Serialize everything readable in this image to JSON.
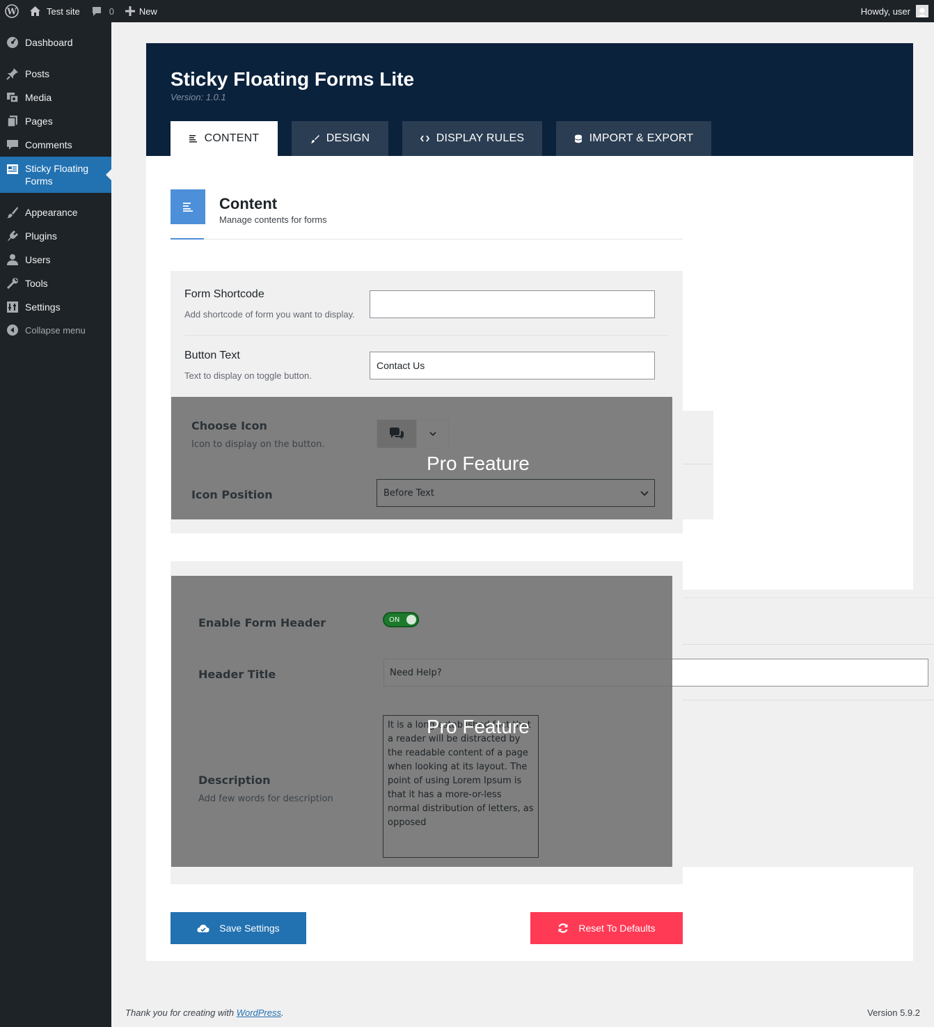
{
  "adminbar": {
    "site_name": "Test site",
    "comments_count": "0",
    "new_label": "New",
    "howdy": "Howdy, user"
  },
  "sidebar": {
    "items": [
      {
        "label": "Dashboard",
        "icon": "dashboard-icon"
      },
      {
        "label": "Posts",
        "icon": "pushpin-icon"
      },
      {
        "label": "Media",
        "icon": "media-icon"
      },
      {
        "label": "Pages",
        "icon": "pages-icon"
      },
      {
        "label": "Comments",
        "icon": "comment-icon"
      },
      {
        "label": "Sticky Floating Forms",
        "label_line1": "Sticky Floating",
        "label_line2": "Forms",
        "icon": "form-icon",
        "current": true
      },
      {
        "label": "Appearance",
        "icon": "brush-icon"
      },
      {
        "label": "Plugins",
        "icon": "plugin-icon"
      },
      {
        "label": "Users",
        "icon": "user-icon"
      },
      {
        "label": "Tools",
        "icon": "wrench-icon"
      },
      {
        "label": "Settings",
        "icon": "settings-icon"
      }
    ],
    "collapse_label": "Collapse menu"
  },
  "plugin": {
    "title": "Sticky Floating Forms Lite",
    "version": "Version: 1.0.1"
  },
  "tabs": [
    {
      "label": "CONTENT",
      "active": true
    },
    {
      "label": "DESIGN",
      "active": false
    },
    {
      "label": "DISPLAY RULES",
      "active": false
    },
    {
      "label": "IMPORT & EXPORT",
      "active": false
    }
  ],
  "section": {
    "title": "Content",
    "description": "Manage contents for forms"
  },
  "fields": {
    "form_shortcode": {
      "label": "Form Shortcode",
      "description": "Add shortcode of form you want to display.",
      "value": ""
    },
    "button_text": {
      "label": "Button Text",
      "description": "Text to display on toggle button.",
      "value": "Contact Us"
    },
    "choose_icon": {
      "label": "Choose Icon",
      "description": "Icon to display on the button."
    },
    "icon_position": {
      "label": "Icon Position",
      "value": "Before Text"
    },
    "enable_form_header": {
      "label": "Enable Form Header",
      "toggle_text": "ON"
    },
    "header_title": {
      "label": "Header Title",
      "value": "Need Help?"
    },
    "description": {
      "label": "Description",
      "description": "Add few words for description",
      "value": "It is a long established fact that a reader will be distracted by the readable content of a page when looking at its layout. The point of using Lorem Ipsum is that it has a more-or-less normal distribution of letters, as opposed"
    }
  },
  "pro_label": "Pro Feature",
  "buttons": {
    "save": "Save Settings",
    "reset": "Reset To Defaults"
  },
  "footer": {
    "thanks_prefix": "Thank you for creating with ",
    "thanks_link": "WordPress",
    "thanks_suffix": ".",
    "version": "Version 5.9.2"
  },
  "colors": {
    "admin_dark": "#1d2327",
    "accent_blue": "#2271b1",
    "header_navy": "#0b223d",
    "reset_red": "#ff3a55",
    "toggle_green": "#1d7a2c"
  }
}
